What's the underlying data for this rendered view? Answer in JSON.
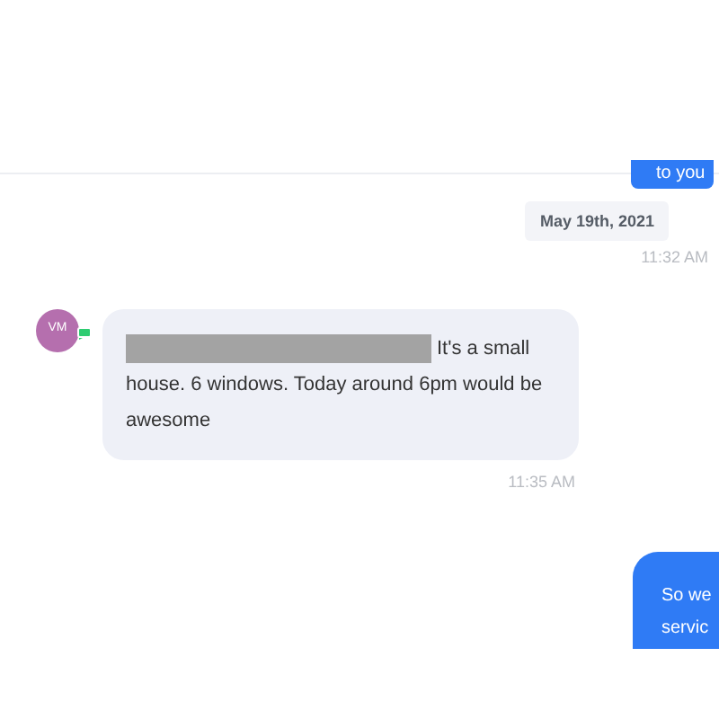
{
  "messages": [
    {
      "kind": "outgoing",
      "lines": [
        "to you"
      ]
    },
    {
      "kind": "date",
      "text": "May 19th, 2021"
    },
    {
      "kind": "time",
      "text": "11:32 AM"
    },
    {
      "kind": "incoming",
      "avatar": "VM",
      "redacted": true,
      "text": "It's a small house. 6 windows. Today around 6pm would be awesome"
    },
    {
      "kind": "time",
      "text": "11:35 AM"
    },
    {
      "kind": "outgoing",
      "lines": [
        "So we",
        "servic"
      ]
    }
  ]
}
